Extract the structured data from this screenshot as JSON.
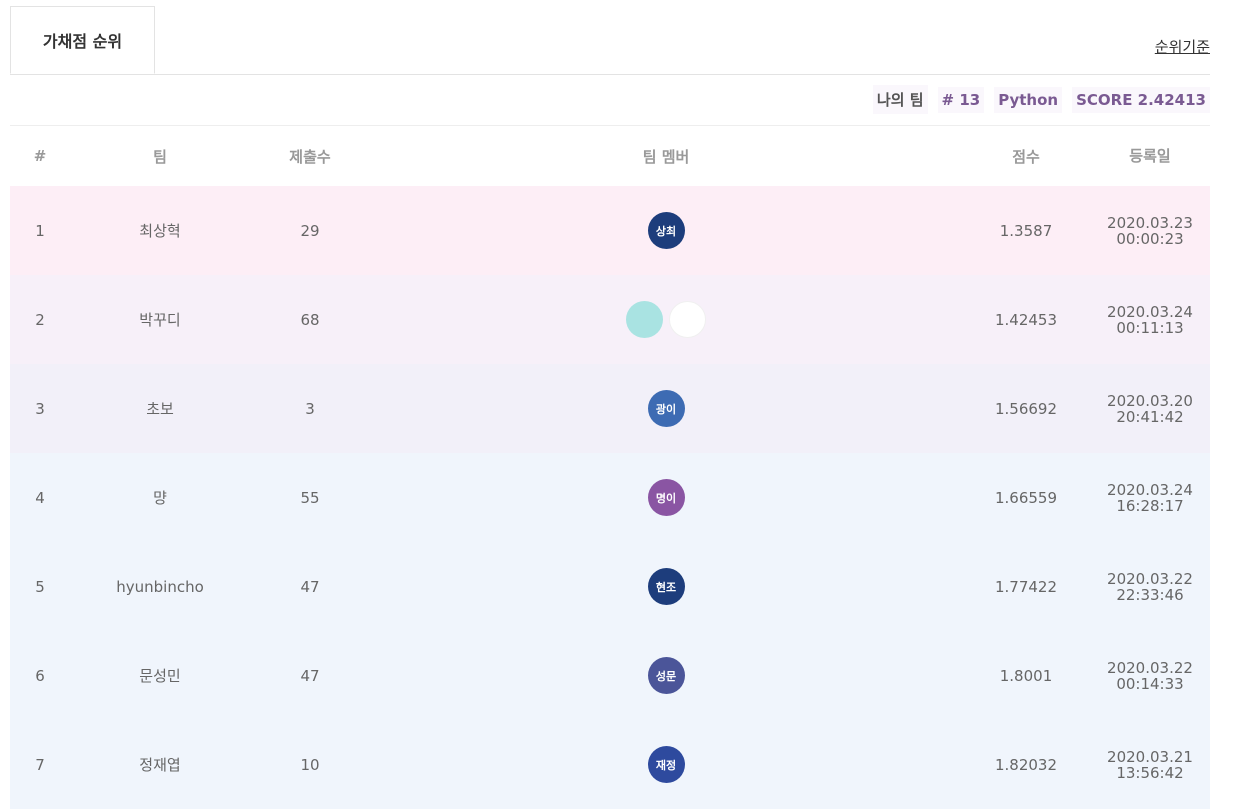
{
  "tabs": {
    "active_label": "가채점 순위",
    "criteria_link": "순위기준"
  },
  "my_team": {
    "label": "나의 팀",
    "rank": "# 13",
    "language": "Python",
    "score": "SCORE 2.42413"
  },
  "table": {
    "headers": {
      "rank": "#",
      "team": "팀",
      "submissions": "제출수",
      "members": "팀 멤버",
      "score": "점수",
      "date": "등록일"
    },
    "rows": [
      {
        "rank": "1",
        "team": "최상혁",
        "submissions": "29",
        "score": "1.3587",
        "date": "2020.03.23",
        "time": "00:00:23",
        "bg": "#fdeef6",
        "members": [
          {
            "label": "상최",
            "color": "#1d3d7c"
          }
        ]
      },
      {
        "rank": "2",
        "team": "박꾸디",
        "submissions": "68",
        "score": "1.42453",
        "date": "2020.03.24",
        "time": "00:11:13",
        "bg": "#f7f0f9",
        "members": [
          {
            "label": "",
            "color": "#a9e3e2"
          },
          {
            "label": "",
            "color": "#ffffff"
          }
        ]
      },
      {
        "rank": "3",
        "team": "초보",
        "submissions": "3",
        "score": "1.56692",
        "date": "2020.03.20",
        "time": "20:41:42",
        "bg": "#f2f0f9",
        "members": [
          {
            "label": "광이",
            "color": "#3d6bb3"
          }
        ]
      },
      {
        "rank": "4",
        "team": "먕",
        "submissions": "55",
        "score": "1.66559",
        "date": "2020.03.24",
        "time": "16:28:17",
        "bg": "#f0f5fc",
        "members": [
          {
            "label": "명이",
            "color": "#8a55a3"
          }
        ]
      },
      {
        "rank": "5",
        "team": "hyunbincho",
        "submissions": "47",
        "score": "1.77422",
        "date": "2020.03.22",
        "time": "22:33:46",
        "bg": "#f0f5fc",
        "members": [
          {
            "label": "현조",
            "color": "#1d3d7c"
          }
        ]
      },
      {
        "rank": "6",
        "team": "문성민",
        "submissions": "47",
        "score": "1.8001",
        "date": "2020.03.22",
        "time": "00:14:33",
        "bg": "#f0f5fc",
        "members": [
          {
            "label": "성문",
            "color": "#4b5599"
          }
        ]
      },
      {
        "rank": "7",
        "team": "정재엽",
        "submissions": "10",
        "score": "1.82032",
        "date": "2020.03.21",
        "time": "13:56:42",
        "bg": "#f0f5fc",
        "members": [
          {
            "label": "재정",
            "color": "#2e4a9e"
          }
        ]
      }
    ]
  }
}
